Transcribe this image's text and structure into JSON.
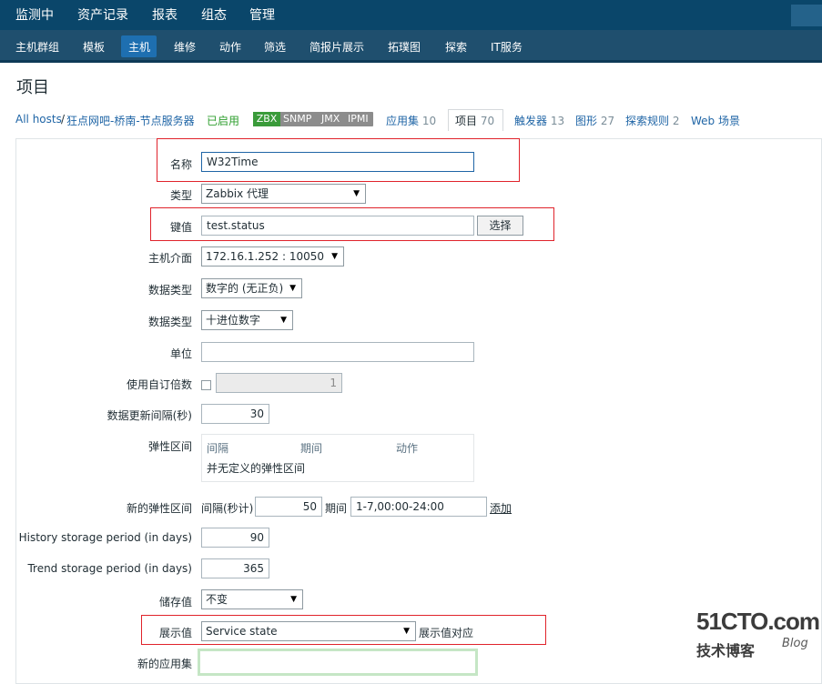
{
  "top_nav": [
    "监测中",
    "资产记录",
    "报表",
    "组态",
    "管理"
  ],
  "sub_nav": [
    "主机群组",
    "模板",
    "主机",
    "维修",
    "动作",
    "筛选",
    "简报片展示",
    "拓璞图",
    "探索",
    "IT服务"
  ],
  "page_title": "项目",
  "breadcrumb": {
    "all_hosts": "All hosts",
    "separator": "/",
    "host": "狂点网吧-桥南-节点服务器",
    "status": "已启用",
    "tags": [
      "ZBX",
      "SNMP",
      "JMX",
      "IPMI"
    ],
    "apps_label": "应用集",
    "apps_count": "10",
    "items_label": "项目",
    "items_count": "70",
    "triggers_label": "触发器",
    "triggers_count": "13",
    "graphs_label": "图形",
    "graphs_count": "27",
    "discovery_label": "探索规则",
    "discovery_count": "2",
    "web_label": "Web 场景"
  },
  "form": {
    "name_label": "名称",
    "name_value": "W32Time",
    "type_label": "类型",
    "type_value": "Zabbix 代理",
    "key_label": "键值",
    "key_value": "test.status",
    "select_button": "选择",
    "interface_label": "主机介面",
    "interface_value": "172.16.1.252 : 10050",
    "data_type1_label": "数据类型",
    "data_type1_value": "数字的 (无正负)",
    "data_type2_label": "数据类型",
    "data_type2_value": "十进位数字",
    "unit_label": "单位",
    "unit_value": "",
    "multiplier_label": "使用自订倍数",
    "multiplier_value": "1",
    "interval_label": "数据更新间隔(秒)",
    "interval_value": "30",
    "flex_label": "弹性区间",
    "flex_headers": [
      "间隔",
      "期间",
      "动作"
    ],
    "flex_empty": "并无定义的弹性区间",
    "new_flex_label": "新的弹性区间",
    "new_flex_interval_label": "间隔(秒计)",
    "new_flex_interval_value": "50",
    "new_flex_period_label": "期间",
    "new_flex_period_value": "1-7,00:00-24:00",
    "add_link": "添加",
    "history_label": "History storage period (in days)",
    "history_value": "90",
    "trend_label": "Trend storage period (in days)",
    "trend_value": "365",
    "store_label": "储存值",
    "store_value": "不变",
    "show_label": "展示值",
    "show_value": "Service state",
    "show_mapping_link": "展示值对应",
    "new_app_label": "新的应用集",
    "new_app_value": ""
  },
  "watermark": {
    "site": "51CTO.com",
    "sub": "技术博客",
    "blog": "Blog"
  },
  "colors": {
    "top_nav_bg": "#0a466a",
    "sub_nav_bg": "#1f4f6e",
    "active_tab": "#1e6fb0",
    "highlight_box": "#e0232b",
    "link": "#1f65a6",
    "enabled": "#2e9e2e"
  }
}
